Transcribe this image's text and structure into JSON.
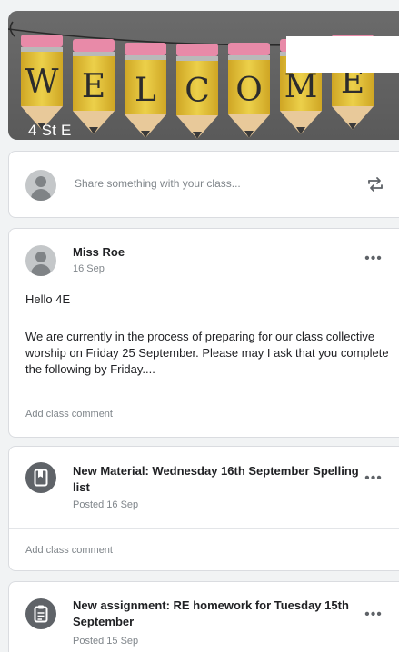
{
  "banner": {
    "title": "4 St E",
    "bunting_letters": [
      "W",
      "E",
      "L",
      "C",
      "O",
      "M",
      "E"
    ]
  },
  "share": {
    "placeholder": "Share something with your class..."
  },
  "post": {
    "author": "Miss Roe",
    "date": "16 Sep",
    "greeting": "Hello 4E",
    "body": "We are currently in the process of preparing for our class collective worship on Friday 25 September. Please may I ask that you complete the following by Friday....",
    "comment_label": "Add class comment"
  },
  "material": {
    "title": "New Material: Wednesday 16th September Spelling list",
    "posted": "Posted 16 Sep",
    "comment_label": "Add class comment"
  },
  "assignment": {
    "title": "New assignment: RE homework for Tuesday 15th September",
    "posted": "Posted 15 Sep"
  },
  "colors": {
    "banner_bg": "#5f5f5f",
    "pencil_body": "#e6c232",
    "pencil_eraser": "#e88aa8",
    "icon_gray": "#5f6368"
  },
  "icons": {
    "repost": "repost-icon",
    "more": "more-vert-icon",
    "material": "book-icon",
    "assignment": "assignment-icon"
  }
}
